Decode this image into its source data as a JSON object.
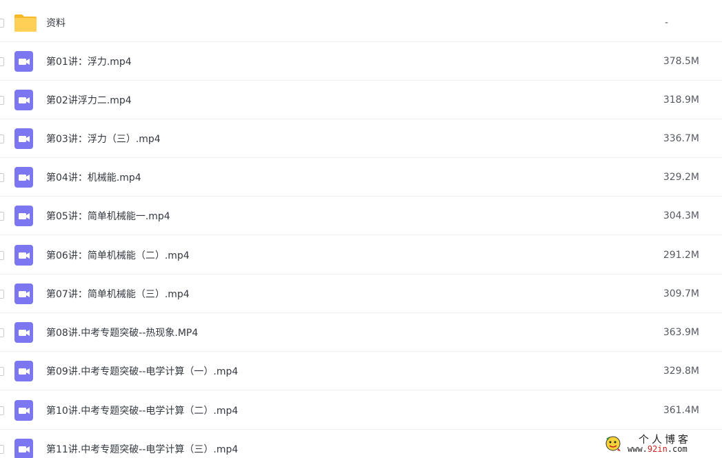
{
  "files": [
    {
      "name": "资料",
      "size": "-",
      "type": "folder",
      "icon": "folder-icon"
    },
    {
      "name": "第01讲：浮力.mp4",
      "size": "378.5M",
      "type": "video",
      "icon": "video-icon"
    },
    {
      "name": "第02讲浮力二.mp4",
      "size": "318.9M",
      "type": "video",
      "icon": "video-icon"
    },
    {
      "name": "第03讲：浮力（三）.mp4",
      "size": "336.7M",
      "type": "video",
      "icon": "video-icon"
    },
    {
      "name": "第04讲：机械能.mp4",
      "size": "329.2M",
      "type": "video",
      "icon": "video-icon"
    },
    {
      "name": "第05讲：简单机械能一.mp4",
      "size": "304.3M",
      "type": "video",
      "icon": "video-icon"
    },
    {
      "name": "第06讲：简单机械能（二）.mp4",
      "size": "291.2M",
      "type": "video",
      "icon": "video-icon"
    },
    {
      "name": "第07讲：简单机械能（三）.mp4",
      "size": "309.7M",
      "type": "video",
      "icon": "video-icon"
    },
    {
      "name": "第08讲.中考专题突破--热现象.MP4",
      "size": "363.9M",
      "type": "video",
      "icon": "video-icon"
    },
    {
      "name": "第09讲.中考专题突破--电学计算（一）.mp4",
      "size": "329.8M",
      "type": "video",
      "icon": "video-icon"
    },
    {
      "name": "第10讲.中考专题突破--电学计算（二）.mp4",
      "size": "361.4M",
      "type": "video",
      "icon": "video-icon"
    },
    {
      "name": "第11讲.中考专题突破--电学计算（三）.mp4",
      "size": "",
      "type": "video",
      "icon": "video-icon"
    }
  ],
  "watermark": {
    "title": "个人博客",
    "url_prefix": "www.",
    "url_highlight": "92in",
    "url_suffix": ".com"
  },
  "colors": {
    "folder": "#ffc94d",
    "video": "#7c76f0",
    "row_border": "#eef0f4",
    "text": "#333840"
  }
}
